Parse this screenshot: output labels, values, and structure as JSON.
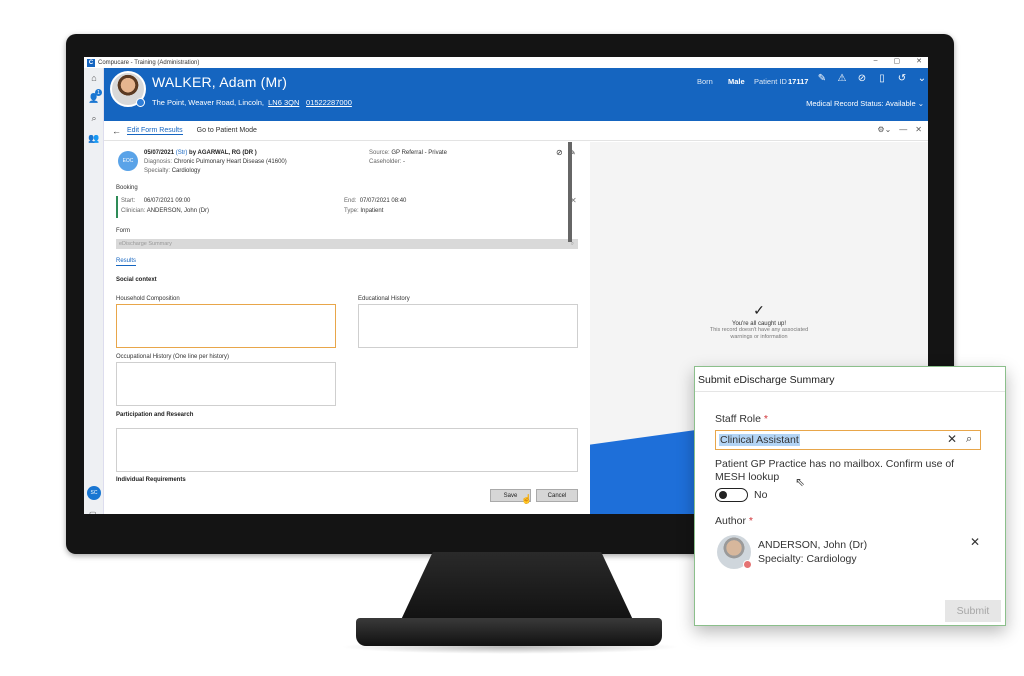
{
  "window": {
    "app_title": "Compucare - Training (Administration)",
    "controls": [
      "–",
      "▢",
      "✕"
    ]
  },
  "leftnav": {
    "badge": "1",
    "user_initials": "SC"
  },
  "patient": {
    "name": "WALKER, Adam (Mr)",
    "address": "The Point, Weaver Road, Lincoln,",
    "postcode": "LN6 3QN",
    "phone": "01522287000",
    "born_label": "Born",
    "sex": "Male",
    "id_label": "Patient ID",
    "id": "17117",
    "record_status": "Medical Record Status: Available",
    "header_icons": [
      "pencil-icon",
      "warning-icon",
      "paperclip-icon",
      "clipboard-icon",
      "history-icon",
      "chevron-down-icon",
      "close-icon"
    ]
  },
  "subbar": {
    "back": "←",
    "edit_form_results": "Edit Form Results",
    "go_to_patient_mode": "Go to Patient Mode"
  },
  "form": {
    "eoc_badge": "EOC",
    "referral_date": "05/07/2021",
    "referral_strong": "(Str)",
    "referral_by": "by AGARWAL, RG (DR",
    "referral_close": ")",
    "diagnosis_label": "Diagnosis:",
    "diagnosis_value": "Chronic Pulmonary Heart Disease  (41600)",
    "specialty_label": "Specialty:",
    "specialty_value": "Cardiology",
    "source_label": "Source:",
    "source_value": "GP Referral - Private",
    "caseholder_label": "Caseholder:",
    "caseholder_value": "-",
    "booking_heading": "Booking",
    "start_label": "Start:",
    "start_value": "06/07/2021 09:00",
    "end_label": "End:",
    "end_value": "07/07/2021 08:40",
    "clinician_label": "Clinician:",
    "clinician_value": "ANDERSON, John (Dr)",
    "type_label": "Type:",
    "type_value": "Inpatient",
    "form_label": "Form",
    "form_value": "eDischarge Summary",
    "results_tab": "Results",
    "social_context": "Social context",
    "household_composition": "Household Composition",
    "educational_history": "Educational History",
    "occupational_history": "Occupational History (One line per history)",
    "participation_research": "Participation and Research",
    "individual_requirements": "Individual Requirements",
    "save": "Save",
    "cancel": "Cancel"
  },
  "right_panel": {
    "title": "You're all caught up!",
    "line1": "This record doesn't have any associated",
    "line2": "warnings or information"
  },
  "dialog": {
    "title": "Submit eDischarge Summary",
    "staff_role_label": "Staff Role",
    "required_mark": "*",
    "staff_role_value": "Clinical Assistant",
    "mesh_message": "Patient GP Practice has no mailbox. Confirm use of MESH lookup",
    "toggle_label": "No",
    "author_label": "Author",
    "author_name": "ANDERSON, John (Dr)",
    "author_specialty": "Specialty: Cardiology",
    "submit": "Submit"
  },
  "colors": {
    "brand_blue": "#1565c0",
    "focus_orange": "#e8a64a",
    "required_red": "#d13438"
  }
}
